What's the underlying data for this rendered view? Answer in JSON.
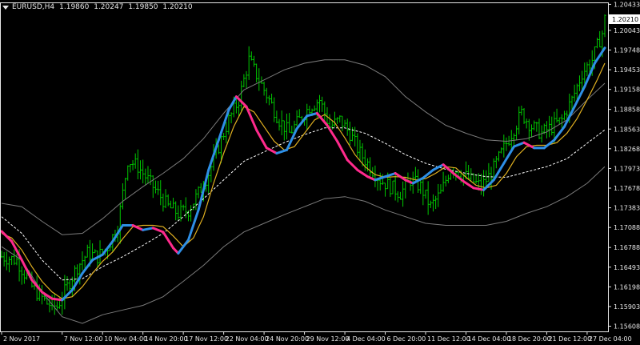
{
  "window": {
    "symbol": "EURUSD,H4",
    "open": "1.19860",
    "high": "1.20247",
    "low": "1.19850",
    "close": "1.20210"
  },
  "colors": {
    "background": "#000000",
    "candles": "#00c800",
    "ma_fast_up": "#2e8fe6",
    "ma_fast_down": "#ff2a8c",
    "ma_signal": "#e0b020",
    "ma_slow": "#ffffff",
    "bands": "#7a7a7a",
    "axis": "#e6e6e6"
  },
  "chart_data": {
    "type": "line",
    "grid": false,
    "current_price": 1.2021,
    "y_ticks": [
      "1.20433",
      "1.20043",
      "1.19748",
      "1.19453",
      "1.19158",
      "1.18858",
      "1.18563",
      "1.18268",
      "1.17973",
      "1.17678",
      "1.17383",
      "1.17088",
      "1.16788",
      "1.16493",
      "1.16198",
      "1.15903",
      "1.15608"
    ],
    "y_tick_values": [
      1.20433,
      1.20043,
      1.19748,
      1.19453,
      1.19158,
      1.18858,
      1.18563,
      1.18268,
      1.17973,
      1.17678,
      1.17383,
      1.17088,
      1.16788,
      1.16493,
      1.16198,
      1.15903,
      1.15608
    ],
    "x_ticks": [
      "2 Nov 2017",
      "7 Nov 12:00",
      "10 Nov 04:00",
      "14 Nov 20:00",
      "17 Nov 12:00",
      "22 Nov 04:00",
      "24 Nov 20:00",
      "29 Nov 12:00",
      "4 Dec 04:00",
      "6 Dec 20:00",
      "11 Dec 12:00",
      "14 Dec 04:00",
      "18 Dec 20:00",
      "21 Dec 12:00",
      "27 Dec 04:00"
    ],
    "x_tick_index": [
      0,
      24,
      40,
      56,
      72,
      88,
      104,
      120,
      136,
      152,
      168,
      184,
      200,
      216,
      232
    ],
    "bar_count": 240,
    "ylim": [
      1.1553,
      1.2045
    ],
    "price_close": [
      [
        0,
        1.1665
      ],
      [
        6,
        1.166
      ],
      [
        12,
        1.162
      ],
      [
        18,
        1.1595
      ],
      [
        22,
        1.159
      ],
      [
        26,
        1.162
      ],
      [
        30,
        1.165
      ],
      [
        34,
        1.167
      ],
      [
        38,
        1.1665
      ],
      [
        42,
        1.168
      ],
      [
        46,
        1.171
      ],
      [
        50,
        1.181
      ],
      [
        54,
        1.18
      ],
      [
        58,
        1.178
      ],
      [
        62,
        1.176
      ],
      [
        66,
        1.174
      ],
      [
        70,
        1.173
      ],
      [
        74,
        1.1735
      ],
      [
        78,
        1.176
      ],
      [
        82,
        1.179
      ],
      [
        86,
        1.183
      ],
      [
        90,
        1.187
      ],
      [
        94,
        1.19
      ],
      [
        98,
        1.196
      ],
      [
        102,
        1.193
      ],
      [
        106,
        1.19
      ],
      [
        110,
        1.187
      ],
      [
        114,
        1.185
      ],
      [
        118,
        1.187
      ],
      [
        122,
        1.189
      ],
      [
        126,
        1.19
      ],
      [
        130,
        1.186
      ],
      [
        134,
        1.187
      ],
      [
        138,
        1.185
      ],
      [
        142,
        1.182
      ],
      [
        146,
        1.18
      ],
      [
        150,
        1.178
      ],
      [
        154,
        1.177
      ],
      [
        158,
        1.176
      ],
      [
        162,
        1.178
      ],
      [
        166,
        1.177
      ],
      [
        170,
        1.174
      ],
      [
        174,
        1.176
      ],
      [
        178,
        1.18
      ],
      [
        182,
        1.179
      ],
      [
        186,
        1.178
      ],
      [
        190,
        1.177
      ],
      [
        194,
        1.179
      ],
      [
        198,
        1.182
      ],
      [
        202,
        1.185
      ],
      [
        206,
        1.188
      ],
      [
        210,
        1.186
      ],
      [
        214,
        1.185
      ],
      [
        218,
        1.186
      ],
      [
        222,
        1.187
      ],
      [
        226,
        1.19
      ],
      [
        230,
        1.194
      ],
      [
        234,
        1.196
      ],
      [
        238,
        1.2
      ],
      [
        239,
        1.2021
      ]
    ],
    "series": [
      {
        "color_up": "#2e8fe6",
        "color_down": "#ff2a8c",
        "values": [
          [
            0,
            1.1703
          ],
          [
            4,
            1.1688
          ],
          [
            8,
            1.166
          ],
          [
            12,
            1.163
          ],
          [
            16,
            1.1612
          ],
          [
            20,
            1.1602
          ],
          [
            24,
            1.16
          ],
          [
            28,
            1.1615
          ],
          [
            32,
            1.164
          ],
          [
            36,
            1.166
          ],
          [
            40,
            1.1668
          ],
          [
            44,
            1.1688
          ],
          [
            48,
            1.1712
          ],
          [
            52,
            1.1712
          ],
          [
            56,
            1.1705
          ],
          [
            60,
            1.1708
          ],
          [
            64,
            1.1702
          ],
          [
            68,
            1.1678
          ],
          [
            70,
            1.167
          ],
          [
            74,
            1.169
          ],
          [
            78,
            1.1735
          ],
          [
            82,
            1.1795
          ],
          [
            86,
            1.184
          ],
          [
            90,
            1.1885
          ],
          [
            93,
            1.1905
          ],
          [
            97,
            1.189
          ],
          [
            101,
            1.1855
          ],
          [
            105,
            1.1828
          ],
          [
            109,
            1.182
          ],
          [
            113,
            1.1825
          ],
          [
            117,
            1.1857
          ],
          [
            121,
            1.1876
          ],
          [
            125,
            1.188
          ],
          [
            129,
            1.1862
          ],
          [
            133,
            1.1838
          ],
          [
            137,
            1.181
          ],
          [
            141,
            1.1795
          ],
          [
            145,
            1.1785
          ],
          [
            148,
            1.178
          ],
          [
            152,
            1.1785
          ],
          [
            156,
            1.179
          ],
          [
            160,
            1.178
          ],
          [
            163,
            1.1775
          ],
          [
            167,
            1.1783
          ],
          [
            171,
            1.1795
          ],
          [
            175,
            1.1803
          ],
          [
            179,
            1.179
          ],
          [
            183,
            1.1778
          ],
          [
            187,
            1.1768
          ],
          [
            191,
            1.1765
          ],
          [
            195,
            1.178
          ],
          [
            199,
            1.1805
          ],
          [
            203,
            1.183
          ],
          [
            207,
            1.1836
          ],
          [
            211,
            1.1828
          ],
          [
            215,
            1.1828
          ],
          [
            219,
            1.184
          ],
          [
            223,
            1.186
          ],
          [
            227,
            1.189
          ],
          [
            231,
            1.192
          ],
          [
            235,
            1.1955
          ],
          [
            239,
            1.1978
          ]
        ]
      },
      {
        "color": "#e0b020",
        "values": [
          [
            0,
            1.17
          ],
          [
            4,
            1.1693
          ],
          [
            8,
            1.1675
          ],
          [
            12,
            1.165
          ],
          [
            16,
            1.1628
          ],
          [
            20,
            1.1612
          ],
          [
            24,
            1.1602
          ],
          [
            28,
            1.1605
          ],
          [
            32,
            1.162
          ],
          [
            36,
            1.164
          ],
          [
            40,
            1.1658
          ],
          [
            44,
            1.1672
          ],
          [
            48,
            1.1692
          ],
          [
            52,
            1.171
          ],
          [
            56,
            1.1712
          ],
          [
            60,
            1.1712
          ],
          [
            64,
            1.171
          ],
          [
            68,
            1.1696
          ],
          [
            72,
            1.168
          ],
          [
            76,
            1.1693
          ],
          [
            80,
            1.1725
          ],
          [
            84,
            1.1775
          ],
          [
            88,
            1.182
          ],
          [
            92,
            1.186
          ],
          [
            96,
            1.189
          ],
          [
            100,
            1.1882
          ],
          [
            104,
            1.186
          ],
          [
            108,
            1.1838
          ],
          [
            112,
            1.1825
          ],
          [
            116,
            1.183
          ],
          [
            120,
            1.185
          ],
          [
            124,
            1.187
          ],
          [
            128,
            1.1878
          ],
          [
            132,
            1.1866
          ],
          [
            136,
            1.1843
          ],
          [
            140,
            1.1818
          ],
          [
            144,
            1.18
          ],
          [
            148,
            1.1788
          ],
          [
            152,
            1.1784
          ],
          [
            156,
            1.1785
          ],
          [
            160,
            1.1784
          ],
          [
            164,
            1.178
          ],
          [
            168,
            1.1782
          ],
          [
            172,
            1.179
          ],
          [
            176,
            1.18
          ],
          [
            180,
            1.1798
          ],
          [
            184,
            1.1784
          ],
          [
            188,
            1.1772
          ],
          [
            192,
            1.1768
          ],
          [
            196,
            1.1772
          ],
          [
            200,
            1.179
          ],
          [
            204,
            1.1815
          ],
          [
            208,
            1.183
          ],
          [
            212,
            1.1832
          ],
          [
            216,
            1.1832
          ],
          [
            220,
            1.1836
          ],
          [
            224,
            1.185
          ],
          [
            228,
            1.1872
          ],
          [
            232,
            1.19
          ],
          [
            236,
            1.193
          ],
          [
            239,
            1.1955
          ]
        ]
      },
      {
        "color": "#ffffff",
        "dashed": true,
        "values": [
          [
            0,
            1.1725
          ],
          [
            8,
            1.17
          ],
          [
            16,
            1.166
          ],
          [
            24,
            1.163
          ],
          [
            32,
            1.1632
          ],
          [
            40,
            1.165
          ],
          [
            48,
            1.1665
          ],
          [
            56,
            1.1682
          ],
          [
            64,
            1.17
          ],
          [
            72,
            1.1725
          ],
          [
            80,
            1.1752
          ],
          [
            88,
            1.178
          ],
          [
            96,
            1.1808
          ],
          [
            104,
            1.1822
          ],
          [
            112,
            1.1836
          ],
          [
            120,
            1.1848
          ],
          [
            128,
            1.1858
          ],
          [
            136,
            1.1858
          ],
          [
            144,
            1.185
          ],
          [
            152,
            1.1835
          ],
          [
            160,
            1.1818
          ],
          [
            168,
            1.1805
          ],
          [
            176,
            1.1796
          ],
          [
            184,
            1.179
          ],
          [
            192,
            1.1785
          ],
          [
            200,
            1.1784
          ],
          [
            208,
            1.1792
          ],
          [
            216,
            1.18
          ],
          [
            224,
            1.1812
          ],
          [
            232,
            1.1835
          ],
          [
            239,
            1.1855
          ]
        ]
      },
      {
        "color": "#7a7a7a",
        "values": [
          [
            0,
            1.1745
          ],
          [
            8,
            1.174
          ],
          [
            16,
            1.1718
          ],
          [
            24,
            1.1698
          ],
          [
            32,
            1.17
          ],
          [
            40,
            1.1722
          ],
          [
            48,
            1.1748
          ],
          [
            56,
            1.177
          ],
          [
            64,
            1.179
          ],
          [
            72,
            1.1812
          ],
          [
            80,
            1.1842
          ],
          [
            88,
            1.188
          ],
          [
            96,
            1.1915
          ],
          [
            104,
            1.193
          ],
          [
            112,
            1.1945
          ],
          [
            120,
            1.1955
          ],
          [
            128,
            1.196
          ],
          [
            136,
            1.196
          ],
          [
            144,
            1.1952
          ],
          [
            152,
            1.1935
          ],
          [
            160,
            1.1905
          ],
          [
            168,
            1.1882
          ],
          [
            176,
            1.1862
          ],
          [
            184,
            1.185
          ],
          [
            192,
            1.184
          ],
          [
            200,
            1.1838
          ],
          [
            208,
            1.1842
          ],
          [
            216,
            1.1852
          ],
          [
            224,
            1.187
          ],
          [
            232,
            1.19
          ],
          [
            239,
            1.1925
          ]
        ]
      },
      {
        "color": "#7a7a7a",
        "values": [
          [
            0,
            1.168
          ],
          [
            8,
            1.166
          ],
          [
            16,
            1.1612
          ],
          [
            24,
            1.1575
          ],
          [
            32,
            1.1565
          ],
          [
            40,
            1.1578
          ],
          [
            48,
            1.1585
          ],
          [
            56,
            1.1592
          ],
          [
            64,
            1.1605
          ],
          [
            72,
            1.1628
          ],
          [
            80,
            1.1652
          ],
          [
            88,
            1.168
          ],
          [
            96,
            1.1702
          ],
          [
            104,
            1.1715
          ],
          [
            112,
            1.1728
          ],
          [
            120,
            1.174
          ],
          [
            128,
            1.1752
          ],
          [
            136,
            1.1755
          ],
          [
            144,
            1.1748
          ],
          [
            152,
            1.1735
          ],
          [
            160,
            1.1725
          ],
          [
            168,
            1.1715
          ],
          [
            176,
            1.1712
          ],
          [
            184,
            1.1712
          ],
          [
            192,
            1.1712
          ],
          [
            200,
            1.1718
          ],
          [
            208,
            1.173
          ],
          [
            216,
            1.174
          ],
          [
            224,
            1.1755
          ],
          [
            232,
            1.1775
          ],
          [
            239,
            1.18
          ]
        ]
      }
    ]
  }
}
